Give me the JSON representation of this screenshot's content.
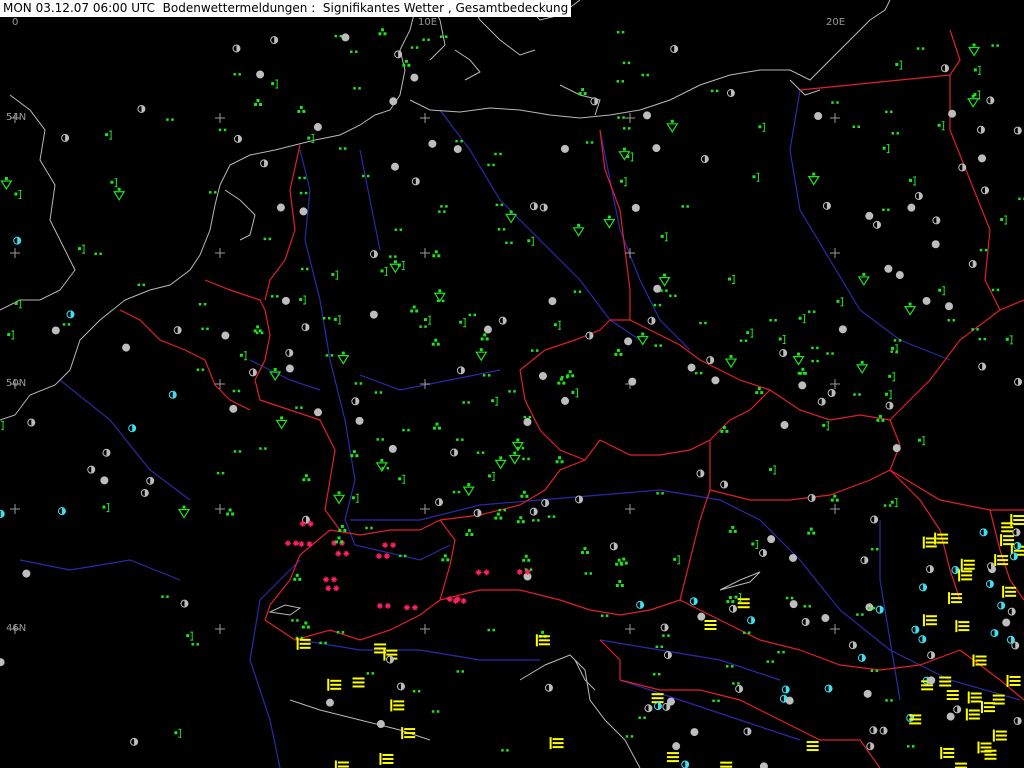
{
  "title": "MON 03.12.07 06:00 UTC  Bodenwettermeldungen :  Signifikantes Wetter , Gesamtbedeckung",
  "grid_labels": {
    "lon_0": "0",
    "lon_10e": "10E",
    "lon_20e": "20E",
    "lat_54n": "54N",
    "lat_50n": "50N",
    "lat_46n": "46N"
  },
  "colors": {
    "background": "#000000",
    "coastline": "#b8b8b8",
    "border": "#e0202a",
    "river": "#2a2aa8",
    "drizzle": "#22e022",
    "rain": "#22e022",
    "shower": "#22e022",
    "snow": "#ff2060",
    "fog": "#ffff00",
    "cloud_symbol": "#bdbdbd",
    "cloud_cyan": "#3ee0f0",
    "grid_cross": "#9a9a9a"
  },
  "symbol_legend": {
    "drizzle": "drizzle-symbol",
    "rain": "rain-symbol",
    "shower": "rain-shower-symbol",
    "snow": "snow-symbol",
    "fog": "fog-symbol",
    "cloud": "cloud-cover-circle"
  }
}
